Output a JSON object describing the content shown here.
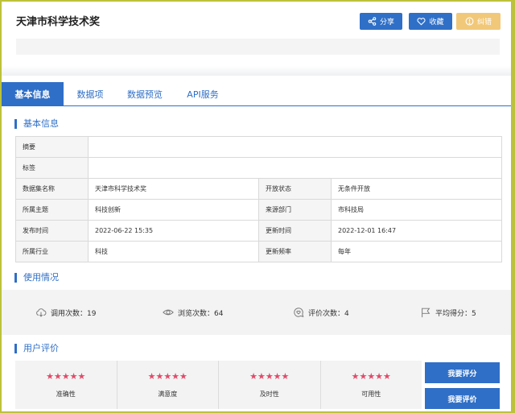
{
  "header": {
    "title": "天津市科学技术奖",
    "share_label": "分享",
    "favorite_label": "收藏",
    "report_label": "纠错"
  },
  "tabs": [
    {
      "label": "基本信息",
      "active": true
    },
    {
      "label": "数据项",
      "active": false
    },
    {
      "label": "数据预览",
      "active": false
    },
    {
      "label": "API服务",
      "active": false
    }
  ],
  "sections": {
    "basic": "基本信息",
    "usage": "使用情况",
    "review": "用户评价"
  },
  "info": {
    "summary_label": "摘要",
    "summary_value": "",
    "tags_label": "标签",
    "tags_value": "",
    "rows": [
      {
        "l1": "数据集名称",
        "v1": "天津市科学技术奖",
        "l2": "开放状态",
        "v2": "无条件开放"
      },
      {
        "l1": "所属主题",
        "v1": "科技创新",
        "l2": "来源部门",
        "v2": "市科技局"
      },
      {
        "l1": "发布时间",
        "v1": "2022-06-22 15:35",
        "l2": "更新时间",
        "v2": "2022-12-01 16:47"
      },
      {
        "l1": "所属行业",
        "v1": "科技",
        "l2": "更新频率",
        "v2": "每年"
      }
    ]
  },
  "usage": {
    "calls": "调用次数：19",
    "views": "浏览次数：64",
    "reviews": "评价次数：4",
    "score": "平均得分：5"
  },
  "ratings": [
    {
      "label": "准确性",
      "stars": "★★★★★"
    },
    {
      "label": "满意度",
      "stars": "★★★★★"
    },
    {
      "label": "及时性",
      "stars": "★★★★★"
    },
    {
      "label": "可用性",
      "stars": "★★★★★"
    }
  ],
  "actions": {
    "rate_label": "我要评分",
    "review_label": "我要评价"
  },
  "colors": {
    "accent": "#2f6fc7",
    "report": "#f1c879",
    "stars": "#e24a6a",
    "frame": "#bcc23a"
  }
}
